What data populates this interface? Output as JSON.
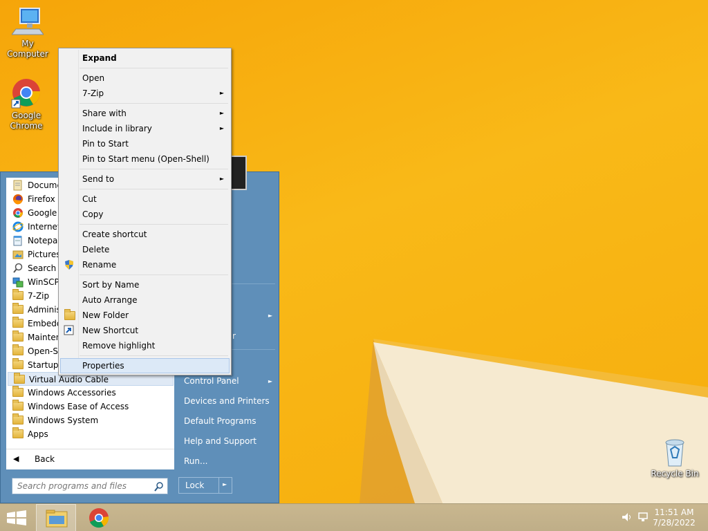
{
  "desktop": {
    "icons": [
      {
        "label": "My Computer",
        "icon": "computer-icon"
      },
      {
        "label": "Google Chrome",
        "icon": "chrome-icon"
      },
      {
        "label": "Recycle Bin",
        "icon": "recycle-bin-icon"
      }
    ]
  },
  "start_menu": {
    "programs": [
      {
        "label": "Documents",
        "icon": "documents-icon"
      },
      {
        "label": "Firefox",
        "icon": "firefox-icon"
      },
      {
        "label": "Google Chrome",
        "icon": "chrome-icon"
      },
      {
        "label": "Internet Explorer",
        "icon": "ie-icon"
      },
      {
        "label": "Notepad",
        "icon": "notepad-icon"
      },
      {
        "label": "Pictures",
        "icon": "pictures-icon"
      },
      {
        "label": "Search",
        "icon": "search-icon"
      },
      {
        "label": "WinSCP",
        "icon": "winscp-icon"
      },
      {
        "label": "7-Zip",
        "icon": "folder-icon"
      },
      {
        "label": "Administrative Tools",
        "icon": "folder-icon"
      },
      {
        "label": "Embedded",
        "icon": "folder-icon"
      },
      {
        "label": "Maintenance",
        "icon": "folder-icon"
      },
      {
        "label": "Open-Shell",
        "icon": "folder-icon"
      },
      {
        "label": "Startup",
        "icon": "folder-icon"
      },
      {
        "label": "Virtual Audio Cable",
        "icon": "folder-icon"
      },
      {
        "label": "Windows Accessories",
        "icon": "folder-icon"
      },
      {
        "label": "Windows Ease of Access",
        "icon": "folder-icon"
      },
      {
        "label": "Windows System",
        "icon": "folder-icon"
      },
      {
        "label": "Apps",
        "icon": "apps-folder-icon"
      }
    ],
    "back_label": "Back",
    "search_placeholder": "Search programs and files",
    "right_items": {
      "obscured_suffix": "r",
      "control_panel": "Control Panel",
      "devices_printers": "Devices and Printers",
      "default_programs": "Default Programs",
      "help_support": "Help and Support",
      "run": "Run..."
    },
    "lock_label": "Lock"
  },
  "context_menu": {
    "items": [
      {
        "label": "Expand",
        "bold": true
      },
      {
        "label": "Open"
      },
      {
        "label": "7-Zip",
        "submenu": true
      },
      {
        "label": "Share with",
        "submenu": true
      },
      {
        "label": "Include in library",
        "submenu": true
      },
      {
        "label": "Pin to Start"
      },
      {
        "label": "Pin to Start menu (Open-Shell)"
      },
      {
        "label": "Send to",
        "submenu": true
      },
      {
        "label": "Cut"
      },
      {
        "label": "Copy"
      },
      {
        "label": "Create shortcut"
      },
      {
        "label": "Delete"
      },
      {
        "label": "Rename",
        "icon": "shield-icon"
      },
      {
        "label": "Sort by Name"
      },
      {
        "label": "Auto Arrange"
      },
      {
        "label": "New Folder",
        "icon": "folder-icon"
      },
      {
        "label": "New Shortcut",
        "icon": "shortcut-icon"
      },
      {
        "label": "Remove highlight"
      },
      {
        "label": "Properties",
        "highlighted": true
      }
    ],
    "submenu_arrow": "►"
  },
  "taskbar": {
    "time": "11:51 AM",
    "date": "7/28/2022"
  },
  "colors": {
    "desktop": "#f8b40f",
    "start_menu": "#5f8fb9",
    "menu_highlight": "#dce9f7"
  }
}
